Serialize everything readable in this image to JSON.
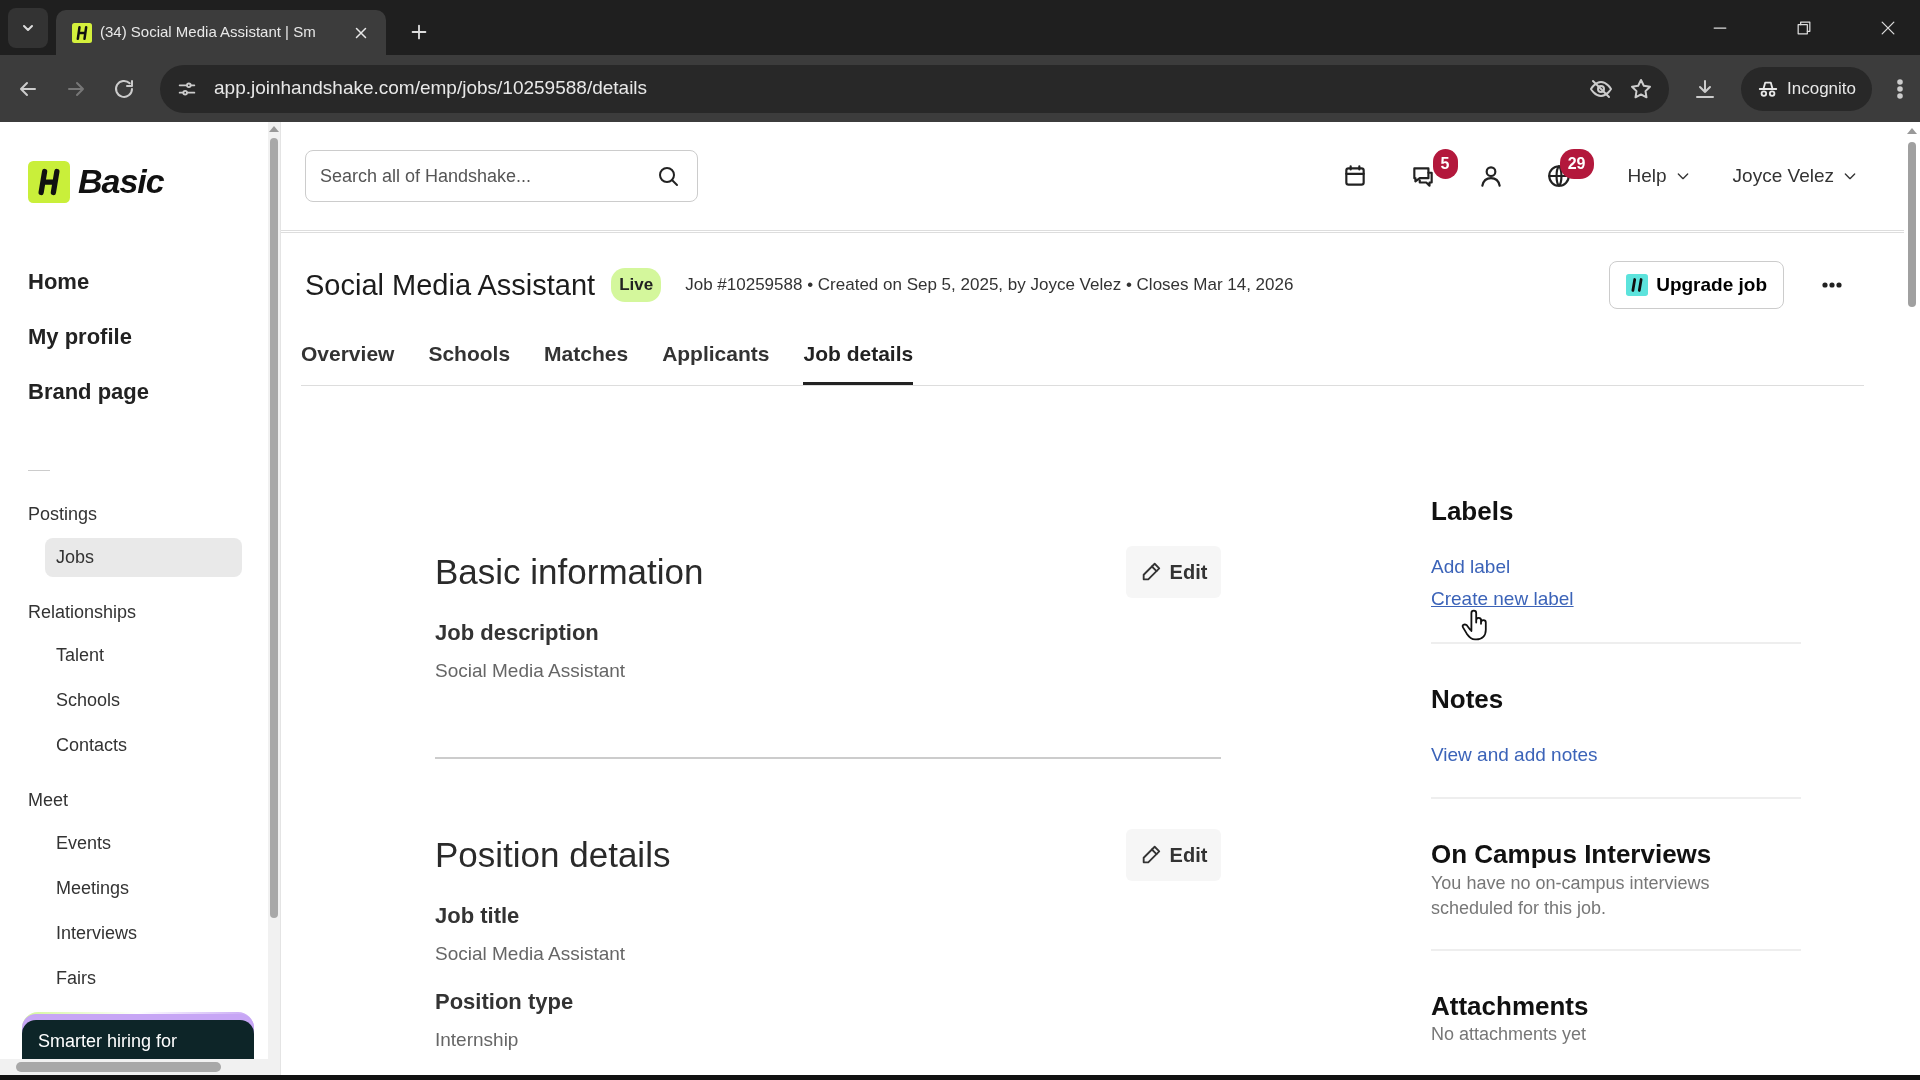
{
  "browser": {
    "tab_title": "(34) Social Media Assistant | Sm",
    "url": "app.joinhandshake.com/emp/jobs/10259588/details",
    "profile": "Incognito"
  },
  "sidebar": {
    "brand": "Basic",
    "primary": [
      {
        "label": "Home"
      },
      {
        "label": "My profile"
      },
      {
        "label": "Brand page"
      }
    ],
    "sections": [
      {
        "heading": "Postings",
        "items": [
          {
            "label": "Jobs",
            "selected": true
          }
        ]
      },
      {
        "heading": "Relationships",
        "items": [
          {
            "label": "Talent",
            "selected": false
          },
          {
            "label": "Schools",
            "selected": false
          },
          {
            "label": "Contacts",
            "selected": false
          }
        ]
      },
      {
        "heading": "Meet",
        "items": [
          {
            "label": "Events",
            "selected": false
          },
          {
            "label": "Meetings",
            "selected": false
          },
          {
            "label": "Interviews",
            "selected": false
          },
          {
            "label": "Fairs",
            "selected": false
          }
        ]
      }
    ],
    "promo": "Smarter hiring for"
  },
  "header": {
    "search_placeholder": "Search all of Handshake...",
    "message_count": "5",
    "notification_count": "29",
    "help": "Help",
    "user": "Joyce Velez"
  },
  "job": {
    "title": "Social Media Assistant",
    "status": "Live",
    "meta": "Job #10259588 • Created on Sep 5, 2025, by Joyce Velez • Closes Mar 14, 2026",
    "upgrade": "Upgrade job"
  },
  "tabs": [
    {
      "label": "Overview",
      "selected": false
    },
    {
      "label": "Schools",
      "selected": false
    },
    {
      "label": "Matches",
      "selected": false
    },
    {
      "label": "Applicants",
      "selected": false
    },
    {
      "label": "Job details",
      "selected": true
    }
  ],
  "sections": [
    {
      "title": "Basic information",
      "edit": "Edit",
      "fields": [
        {
          "label": "Job description",
          "value": "Social Media Assistant"
        }
      ]
    },
    {
      "title": "Position details",
      "edit": "Edit",
      "fields": [
        {
          "label": "Job title",
          "value": "Social Media Assistant"
        },
        {
          "label": "Position type",
          "value": "Internship"
        }
      ]
    }
  ],
  "side_panels": [
    {
      "title": "Labels",
      "links": [
        {
          "label": "Add label",
          "hovered": false
        },
        {
          "label": "Create new label",
          "hovered": true
        }
      ]
    },
    {
      "title": "Notes",
      "links": [
        {
          "label": "View and add notes",
          "hovered": false
        }
      ]
    },
    {
      "title": "On Campus Interviews",
      "text": "You have no on-campus interviews scheduled for this job."
    },
    {
      "title": "Attachments",
      "text": "No attachments yet"
    }
  ]
}
